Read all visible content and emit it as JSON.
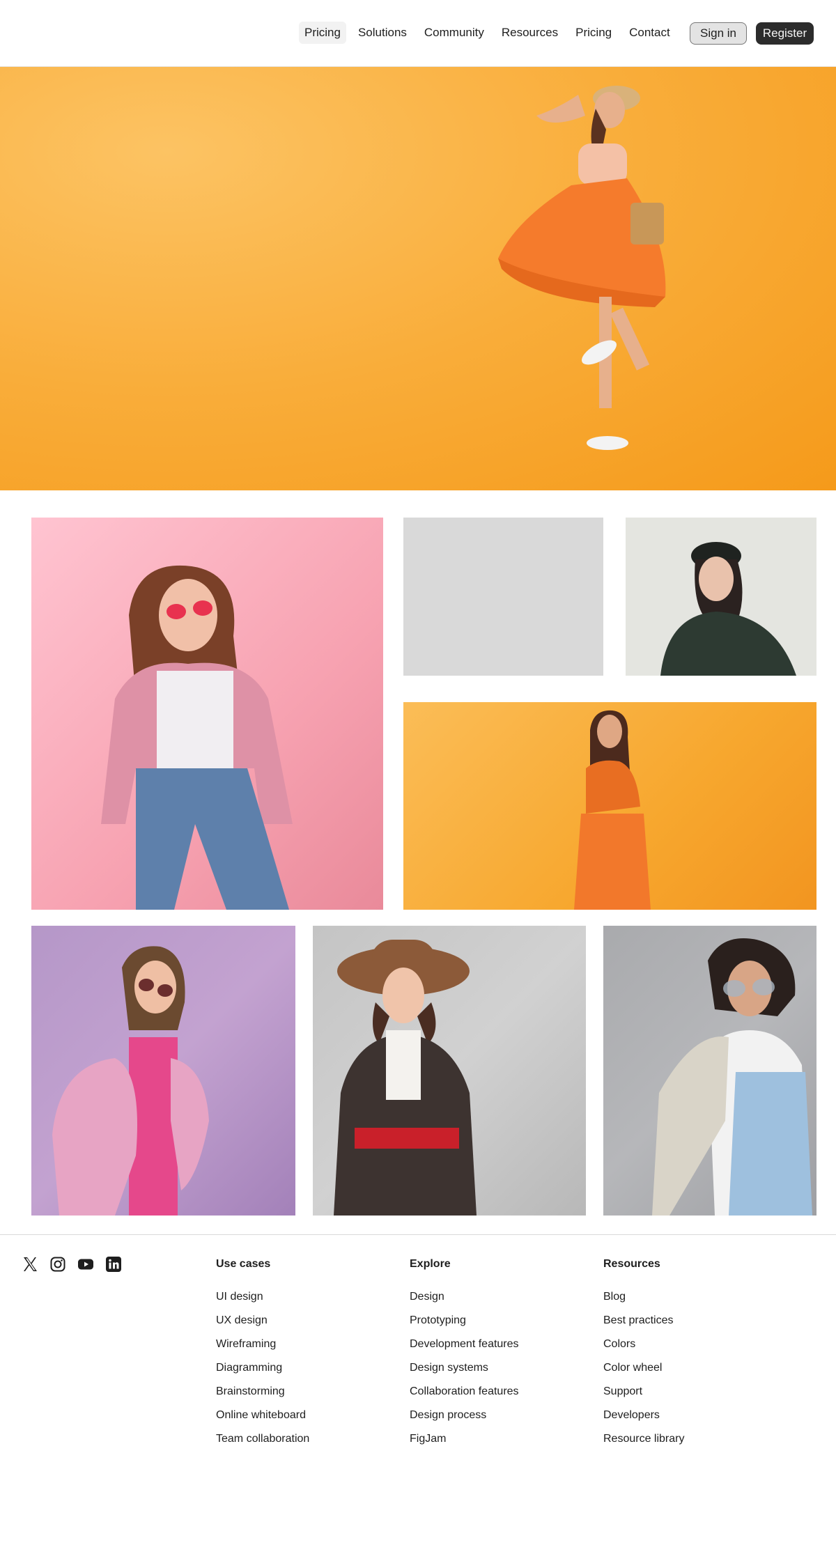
{
  "nav": {
    "items": [
      {
        "label": "Pricing",
        "active": true
      },
      {
        "label": "Solutions",
        "active": false
      },
      {
        "label": "Community",
        "active": false
      },
      {
        "label": "Resources",
        "active": false
      },
      {
        "label": "Pricing",
        "active": false
      },
      {
        "label": "Contact",
        "active": false
      }
    ],
    "signin_label": "Sign in",
    "register_label": "Register"
  },
  "images": [
    {
      "name": "hero-image",
      "subject": "woman in orange skirt with straw hat and basket on orange background"
    },
    {
      "name": "gallery-image-pink",
      "subject": "woman in pink blazer and heart sunglasses on pink background"
    },
    {
      "name": "gallery-image-placeholder",
      "subject": "empty gray image placeholder"
    },
    {
      "name": "gallery-image-cap",
      "subject": "woman in black cap and dark jacket on light background"
    },
    {
      "name": "gallery-image-orange",
      "subject": "woman in orange sweater and skirt on orange background"
    },
    {
      "name": "gallery-image-purple",
      "subject": "woman in pink fluffy coat and sunglasses on purple background"
    },
    {
      "name": "gallery-image-hat",
      "subject": "woman in brown hat and floral jacket with red belt on gray background"
    },
    {
      "name": "gallery-image-overalls",
      "subject": "woman in clear glasses and denim overalls on gray background"
    }
  ],
  "footer": {
    "social": [
      "x-icon",
      "instagram-icon",
      "youtube-icon",
      "linkedin-icon"
    ],
    "columns": [
      {
        "title": "Use cases",
        "items": [
          "UI design",
          "UX design",
          "Wireframing",
          "Diagramming",
          "Brainstorming",
          "Online whiteboard",
          "Team collaboration"
        ]
      },
      {
        "title": "Explore",
        "items": [
          "Design",
          "Prototyping",
          "Development features",
          "Design systems",
          "Collaboration features",
          "Design process",
          "FigJam"
        ]
      },
      {
        "title": "Resources",
        "items": [
          "Blog",
          "Best practices",
          "Colors",
          "Color wheel",
          "Support",
          "Developers",
          "Resource library"
        ]
      }
    ]
  },
  "colors": {
    "accent_dark": "#2c2c2c",
    "hero_orange": "#f9ad3a",
    "placeholder_gray": "#d9d9d9"
  }
}
